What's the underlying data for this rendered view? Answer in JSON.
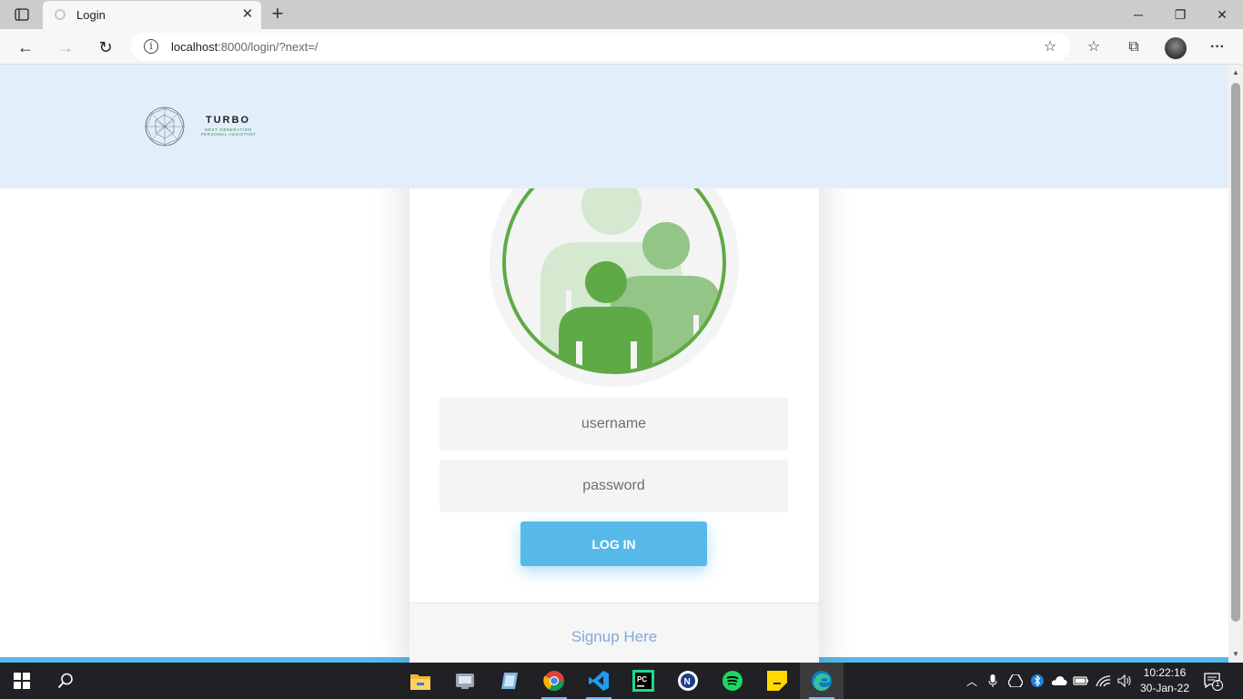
{
  "browser": {
    "tab": {
      "title": "Login",
      "close_glyph": "✕"
    },
    "new_tab_glyph": "+",
    "window_controls": {
      "minimize": "─",
      "restore": "❐",
      "close": "✕"
    },
    "address": {
      "host": "localhost",
      "rest": ":8000/login/?next=/"
    },
    "nav": {
      "back": "←",
      "forward": "→",
      "refresh": "↻"
    },
    "tools": {
      "favorites_add": "☆",
      "favorites": "☆",
      "collections": "⧉",
      "menu": "···"
    },
    "info_glyph": "i"
  },
  "site": {
    "logo": {
      "title": "TURBO",
      "subtitle_line1": "NEXT GENERATION",
      "subtitle_line2": "PERSONAL ASSISTANT"
    }
  },
  "login": {
    "username_placeholder": "username",
    "password_placeholder": "password",
    "submit_label": "LOG IN",
    "signup_link": "Signup Here"
  },
  "colors": {
    "header_bg": "#e2effa",
    "accent_blue": "#56b9e9",
    "avatar_green_dark": "#5faa46",
    "avatar_green_mid": "#93c587",
    "avatar_green_light": "#d5e8d0"
  },
  "taskbar": {
    "apps": [
      "start-icon",
      "search-icon",
      "file-explorer-icon",
      "app-icon",
      "app-icon",
      "chrome-icon",
      "vscode-icon",
      "pycharm-icon",
      "app-icon",
      "spotify-icon",
      "sticky-notes-icon",
      "edge-icon"
    ],
    "clock": {
      "time": "10:22:16",
      "date": "30-Jan-22"
    },
    "notification_count": "1"
  }
}
